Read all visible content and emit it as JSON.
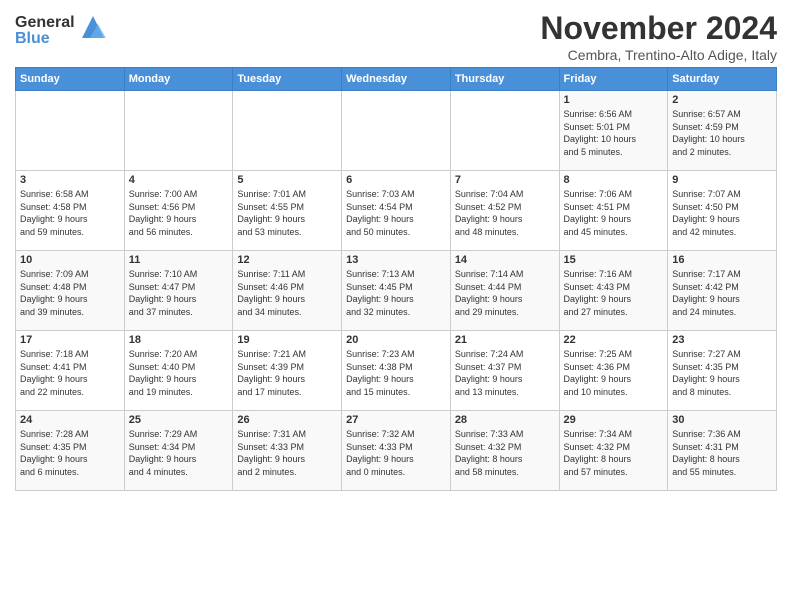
{
  "logo": {
    "line1": "General",
    "line2": "Blue"
  },
  "title": "November 2024",
  "subtitle": "Cembra, Trentino-Alto Adige, Italy",
  "days_of_week": [
    "Sunday",
    "Monday",
    "Tuesday",
    "Wednesday",
    "Thursday",
    "Friday",
    "Saturday"
  ],
  "weeks": [
    [
      {
        "day": "",
        "info": ""
      },
      {
        "day": "",
        "info": ""
      },
      {
        "day": "",
        "info": ""
      },
      {
        "day": "",
        "info": ""
      },
      {
        "day": "",
        "info": ""
      },
      {
        "day": "1",
        "info": "Sunrise: 6:56 AM\nSunset: 5:01 PM\nDaylight: 10 hours\nand 5 minutes."
      },
      {
        "day": "2",
        "info": "Sunrise: 6:57 AM\nSunset: 4:59 PM\nDaylight: 10 hours\nand 2 minutes."
      }
    ],
    [
      {
        "day": "3",
        "info": "Sunrise: 6:58 AM\nSunset: 4:58 PM\nDaylight: 9 hours\nand 59 minutes."
      },
      {
        "day": "4",
        "info": "Sunrise: 7:00 AM\nSunset: 4:56 PM\nDaylight: 9 hours\nand 56 minutes."
      },
      {
        "day": "5",
        "info": "Sunrise: 7:01 AM\nSunset: 4:55 PM\nDaylight: 9 hours\nand 53 minutes."
      },
      {
        "day": "6",
        "info": "Sunrise: 7:03 AM\nSunset: 4:54 PM\nDaylight: 9 hours\nand 50 minutes."
      },
      {
        "day": "7",
        "info": "Sunrise: 7:04 AM\nSunset: 4:52 PM\nDaylight: 9 hours\nand 48 minutes."
      },
      {
        "day": "8",
        "info": "Sunrise: 7:06 AM\nSunset: 4:51 PM\nDaylight: 9 hours\nand 45 minutes."
      },
      {
        "day": "9",
        "info": "Sunrise: 7:07 AM\nSunset: 4:50 PM\nDaylight: 9 hours\nand 42 minutes."
      }
    ],
    [
      {
        "day": "10",
        "info": "Sunrise: 7:09 AM\nSunset: 4:48 PM\nDaylight: 9 hours\nand 39 minutes."
      },
      {
        "day": "11",
        "info": "Sunrise: 7:10 AM\nSunset: 4:47 PM\nDaylight: 9 hours\nand 37 minutes."
      },
      {
        "day": "12",
        "info": "Sunrise: 7:11 AM\nSunset: 4:46 PM\nDaylight: 9 hours\nand 34 minutes."
      },
      {
        "day": "13",
        "info": "Sunrise: 7:13 AM\nSunset: 4:45 PM\nDaylight: 9 hours\nand 32 minutes."
      },
      {
        "day": "14",
        "info": "Sunrise: 7:14 AM\nSunset: 4:44 PM\nDaylight: 9 hours\nand 29 minutes."
      },
      {
        "day": "15",
        "info": "Sunrise: 7:16 AM\nSunset: 4:43 PM\nDaylight: 9 hours\nand 27 minutes."
      },
      {
        "day": "16",
        "info": "Sunrise: 7:17 AM\nSunset: 4:42 PM\nDaylight: 9 hours\nand 24 minutes."
      }
    ],
    [
      {
        "day": "17",
        "info": "Sunrise: 7:18 AM\nSunset: 4:41 PM\nDaylight: 9 hours\nand 22 minutes."
      },
      {
        "day": "18",
        "info": "Sunrise: 7:20 AM\nSunset: 4:40 PM\nDaylight: 9 hours\nand 19 minutes."
      },
      {
        "day": "19",
        "info": "Sunrise: 7:21 AM\nSunset: 4:39 PM\nDaylight: 9 hours\nand 17 minutes."
      },
      {
        "day": "20",
        "info": "Sunrise: 7:23 AM\nSunset: 4:38 PM\nDaylight: 9 hours\nand 15 minutes."
      },
      {
        "day": "21",
        "info": "Sunrise: 7:24 AM\nSunset: 4:37 PM\nDaylight: 9 hours\nand 13 minutes."
      },
      {
        "day": "22",
        "info": "Sunrise: 7:25 AM\nSunset: 4:36 PM\nDaylight: 9 hours\nand 10 minutes."
      },
      {
        "day": "23",
        "info": "Sunrise: 7:27 AM\nSunset: 4:35 PM\nDaylight: 9 hours\nand 8 minutes."
      }
    ],
    [
      {
        "day": "24",
        "info": "Sunrise: 7:28 AM\nSunset: 4:35 PM\nDaylight: 9 hours\nand 6 minutes."
      },
      {
        "day": "25",
        "info": "Sunrise: 7:29 AM\nSunset: 4:34 PM\nDaylight: 9 hours\nand 4 minutes."
      },
      {
        "day": "26",
        "info": "Sunrise: 7:31 AM\nSunset: 4:33 PM\nDaylight: 9 hours\nand 2 minutes."
      },
      {
        "day": "27",
        "info": "Sunrise: 7:32 AM\nSunset: 4:33 PM\nDaylight: 9 hours\nand 0 minutes."
      },
      {
        "day": "28",
        "info": "Sunrise: 7:33 AM\nSunset: 4:32 PM\nDaylight: 8 hours\nand 58 minutes."
      },
      {
        "day": "29",
        "info": "Sunrise: 7:34 AM\nSunset: 4:32 PM\nDaylight: 8 hours\nand 57 minutes."
      },
      {
        "day": "30",
        "info": "Sunrise: 7:36 AM\nSunset: 4:31 PM\nDaylight: 8 hours\nand 55 minutes."
      }
    ]
  ]
}
